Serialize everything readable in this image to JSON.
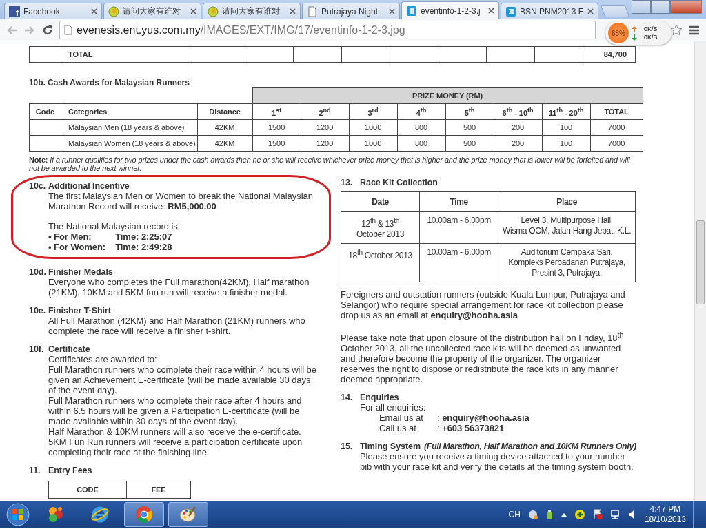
{
  "browser": {
    "tabs": [
      {
        "title": "Facebook",
        "kind": "facebook",
        "glyph": "f",
        "selected": false
      },
      {
        "title": "请问大家有谁对",
        "kind": "chat",
        "selected": false
      },
      {
        "title": "请问大家有谁对",
        "kind": "chat",
        "selected": false
      },
      {
        "title": "Putrajaya Night",
        "kind": "page",
        "selected": false
      },
      {
        "title": "eventinfo-1-2-3.j",
        "kind": "site",
        "selected": true
      },
      {
        "title": "BSN PNM2013 E",
        "kind": "site",
        "selected": false
      }
    ],
    "url_host": "evenesis.ent.yus.com.my",
    "url_path": "/IMAGES/EXT/IMG/17/eventinfo-1-2-3.jpg"
  },
  "speed_widget": {
    "percent": "68%",
    "upload": "0K/S",
    "download": "0K/S"
  },
  "document": {
    "total_row": {
      "label": "TOTAL",
      "value": "84,700"
    },
    "cash_awards": {
      "heading": "10b. Cash Awards for Malaysian Runners",
      "group_header": "PRIZE MONEY (RM)",
      "columns": [
        "Code",
        "Categories",
        "Distance",
        "1$^{st}$",
        "2$^{nd}$",
        "3$^{rd}$",
        "4$^{th}$",
        "5$^{th}$",
        "6$^{th}$ - 10$^{th}$",
        "11$^{th}$ - 20$^{th}$",
        "TOTAL"
      ],
      "rows": [
        {
          "category": "Malaysian Men (18 years & above)",
          "distance": "42KM",
          "prizes": [
            "1500",
            "1200",
            "1000",
            "800",
            "500",
            "200",
            "100"
          ],
          "total": "7000"
        },
        {
          "category": "Malaysian Women (18 years & above)",
          "distance": "42KM",
          "prizes": [
            "1500",
            "1200",
            "1000",
            "800",
            "500",
            "200",
            "100"
          ],
          "total": "7000"
        }
      ]
    },
    "note": "**Note:** *If a runner qualifies for two prizes under the cash awards then he or she will receive whichever prize money that is higher and the prize money that is lower will be forfeited and will not be awarded to the next winner.*",
    "left_sections": [
      {
        "number": "10c.",
        "title": "Additional Incentive",
        "circled": true,
        "blocks": [
          {
            "kind": "paragraph",
            "text": "The first Malaysian Men or Women to break the National Malaysian Marathon Record will receive: **RM5,000.00**"
          },
          {
            "kind": "paragraph",
            "text": "The National Malaysian record is:"
          },
          {
            "kind": "bullets",
            "items": [
              {
                "label": "• For Men:",
                "value": "Time: 2:25:07"
              },
              {
                "label": "• For Women:",
                "value": "Time: 2:49:28"
              }
            ]
          }
        ]
      },
      {
        "number": "10d.",
        "title": "Finisher Medals",
        "blocks": [
          {
            "kind": "paragraph",
            "text": "Everyone who completes the Full marathon(42KM), Half marathon (21KM), 10KM and 5KM fun run will receive a finisher medal."
          }
        ]
      },
      {
        "number": "10e.",
        "title": "Finisher T-Shirt",
        "blocks": [
          {
            "kind": "paragraph",
            "text": "All Full Marathon (42KM) and Half Marathon (21KM) runners who complete the race will receive a finisher t-shirt."
          }
        ]
      },
      {
        "number": "10f.",
        "title": "Certificate",
        "blocks": [
          {
            "kind": "line",
            "text": "Certificates are awarded to:"
          },
          {
            "kind": "line",
            "text": "Full Marathon runners who complete their race within 4 hours will be given an Achievement E-certificate (will be made available 30 days of the event day)."
          },
          {
            "kind": "line",
            "text": "Full Marathon runners who complete their race after 4 hours and within 6.5 hours will be given a Participation E-certificate (will be made available within 30 days of the event day)."
          },
          {
            "kind": "line",
            "text": "Half Marathon & 10KM runners will also receive the e-certificate."
          },
          {
            "kind": "line",
            "text": "5KM Fun Run runners will receive a participation certificate upon completing their race at the finishing line."
          }
        ]
      },
      {
        "number": "11.",
        "title": "Entry Fees",
        "blocks": [
          {
            "kind": "fee_table",
            "columns": [
              "CODE",
              "FEE"
            ]
          }
        ]
      }
    ],
    "right_sections": [
      {
        "number": "13.",
        "title": "Race Kit Collection",
        "blocks": [
          {
            "kind": "kit_table",
            "columns": [
              "Date",
              "Time",
              "Place"
            ],
            "rows": [
              [
                [
                  "12$^{th}$ & 13$^{th}$",
                  "October 2013"
                ],
                [
                  "10.00am - 6.00pm"
                ],
                [
                  "Level 3, Multipurpose Hall,",
                  "Wisma OCM, Jalan Hang Jebat, K.L."
                ]
              ],
              [
                [
                  "18$^{th}$ October 2013"
                ],
                [
                  "10.00am - 6.00pm"
                ],
                [
                  "Auditorium Cempaka Sari,",
                  "Kompleks Perbadanan Putrajaya,",
                  "Presint 3, Putrajaya."
                ]
              ]
            ]
          },
          {
            "kind": "paragraph",
            "text": "Foreigners and outstation runners (outside Kuala Lumpur, Putrajaya and Selangor) who require special arrangement for race kit collection please drop us as an email at **enquiry@hooha.asia**"
          },
          {
            "kind": "paragraph",
            "text": "Please take note that upon closure of the distribution hall on Friday, 18$^{th}$ October 2013, all the uncollected race kits will be deemed as unwanted and therefore become the property of the organizer. The organizer reserves the right to dispose or redistribute the race kits in any manner deemed appropriate."
          }
        ]
      },
      {
        "number": "14.",
        "title": "Enquiries",
        "blocks": [
          {
            "kind": "line",
            "text": "For all enquiries:"
          },
          {
            "kind": "contacts",
            "items": [
              {
                "label": "Email us at",
                "value": ": **enquiry@hooha.asia**"
              },
              {
                "label": "Call us at",
                "value": ": **+603 56373821**"
              }
            ]
          }
        ]
      },
      {
        "number": "15.",
        "title": "Timing System",
        "subtitle": "(Full Marathon, Half Marathon and 10KM Runners Only)",
        "blocks": [
          {
            "kind": "line",
            "text": "Please ensure you receive a timing device attached to your number bib with your race kit and verify the details at the timing system booth."
          }
        ]
      }
    ]
  },
  "taskbar": {
    "apps": [
      {
        "kind": "circles",
        "active": false
      },
      {
        "kind": "e-logo",
        "active": false
      },
      {
        "kind": "chrome",
        "active": true
      },
      {
        "kind": "palette",
        "active": true
      }
    ],
    "language": "CH",
    "time": "4:47 PM",
    "date": "18/10/2013"
  }
}
